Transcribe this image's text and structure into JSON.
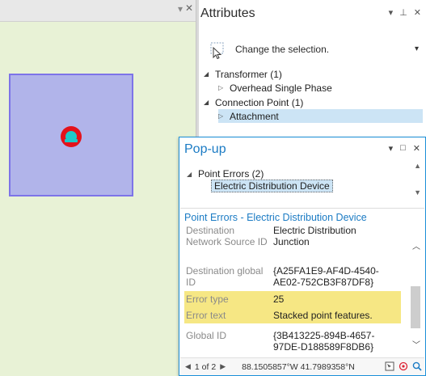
{
  "map": {
    "topbar_chevron": "▾",
    "topbar_close": "✕"
  },
  "attributes": {
    "title": "Attributes",
    "controls": {
      "options": "▾",
      "pin": "⊥",
      "close": "✕"
    },
    "change_selection": {
      "label": "Change the selection.",
      "caret": "▾"
    },
    "tree": [
      {
        "label": "Transformer (1)",
        "expanded": true
      },
      {
        "label": "Overhead Single Phase",
        "expanded": false
      },
      {
        "label": "Connection Point (1)",
        "expanded": true
      },
      {
        "label": "Attachment",
        "expanded": false,
        "selected": true
      }
    ]
  },
  "popup": {
    "title": "Pop-up",
    "controls": {
      "options": "▾",
      "maximize": "□",
      "close": "✕"
    },
    "feature_list": {
      "group": "Point Errors  (2)",
      "item": "Electric Distribution Device"
    },
    "heading": "Point Errors - Electric Distribution Device",
    "fields": [
      {
        "key": "Destination",
        "value": "Electric Distribution"
      },
      {
        "key": "Network Source ID",
        "value": "Junction"
      },
      {
        "key": "Destination global ID",
        "value": "{A25FA1E9-AF4D-4540-AE02-752CB3F87DF8}"
      },
      {
        "key": "Error type",
        "value": "25",
        "highlight": true
      },
      {
        "key": "Error text",
        "value": "Stacked point features.",
        "highlight": true
      },
      {
        "key": "Global ID",
        "value": "{3B413225-894B-4657-97DE-D188589F8DB6}"
      }
    ],
    "status": {
      "prev": "◀",
      "page": "1 of 2",
      "next": "▶",
      "coordinates": "88.1505857°W 41.7989358°N"
    }
  },
  "colors": {
    "accent": "#1b7bc4",
    "map_background": "#e8f2d6",
    "polygon_fill": "#b1b4ea",
    "polygon_stroke": "#7d74e8",
    "point_outer": "#e4121b",
    "point_inner": "#1fc9c9",
    "highlight": "#f6e784",
    "selection": "#cce4f5"
  }
}
